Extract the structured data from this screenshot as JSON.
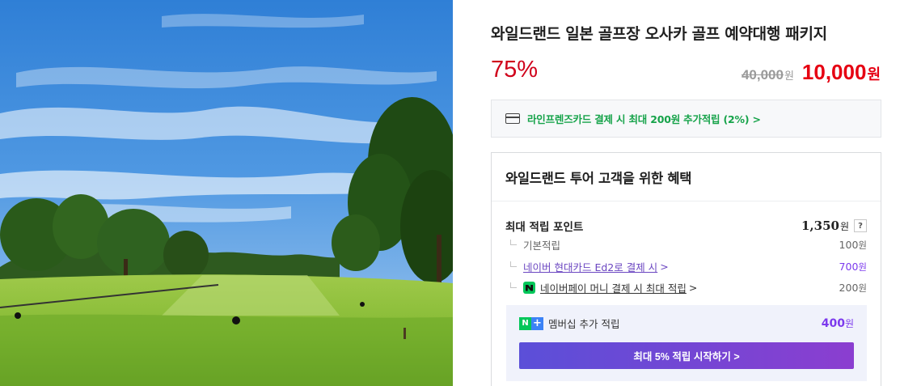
{
  "product": {
    "title": "와일드랜드 일본 골프장 오사카 골프 예약대행 패키지",
    "discount": "75%",
    "original_price": "40,000",
    "original_unit": "원",
    "sale_price": "10,000",
    "sale_unit": "원"
  },
  "card_promo": {
    "icon": "credit-card-icon",
    "text": "라인프렌즈카드 결제 시 최대 200원 추가적립 (2%) >"
  },
  "benefit": {
    "heading": "와일드랜드 투어 고객을 위한 혜택",
    "max_points_label": "최대 적립 포인트",
    "max_points_value": "1,350",
    "max_points_unit": "원",
    "help": "?",
    "items": [
      {
        "label": "기본적립",
        "value": "100",
        "unit": "원"
      },
      {
        "label": "네이버 현대카드 Ed2로 결제 시",
        "chevron": ">",
        "value": "700",
        "unit": "원"
      },
      {
        "label": "네이버페이 머니 결제 시 최대 적립",
        "chevron": ">",
        "value": "200",
        "unit": "원"
      }
    ],
    "membership": {
      "badge_n": "N",
      "badge_plus": "+",
      "label": "멤버십 추가 적립",
      "value": "400",
      "unit": "원",
      "button": "최대 5% 적립 시작하기 >"
    }
  },
  "colors": {
    "discount": "#d0021b",
    "sale_price": "#e60012",
    "card_promo": "#16a34a",
    "purple": "#7c3aed",
    "naver_green": "#03c75a"
  }
}
